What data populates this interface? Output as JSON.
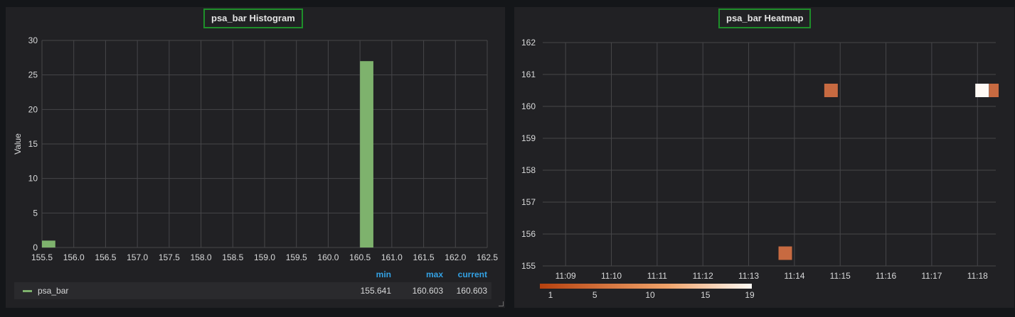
{
  "histogram_panel": {
    "title": "psa_bar Histogram",
    "legend": {
      "headers": [
        "min",
        "max",
        "current"
      ],
      "series_name": "psa_bar",
      "min": "155.641",
      "max": "160.603",
      "current": "160.603"
    }
  },
  "heatmap_panel": {
    "title": "psa_bar Heatmap",
    "color_legend": {
      "ticks": [
        "1",
        "5",
        "10",
        "15",
        "19"
      ],
      "colors": [
        "#b7410e",
        "#fffaf5"
      ]
    }
  },
  "colors": {
    "bar": "#7eb26d",
    "accent_header": "#33a2e5",
    "title_border": "#1e8f2a",
    "panel_bg": "#212124"
  },
  "chart_data": [
    {
      "type": "bar",
      "title": "psa_bar Histogram",
      "xlabel": "",
      "ylabel": "Value",
      "x_ticks": [
        "155.5",
        "156.0",
        "156.5",
        "157.0",
        "157.5",
        "158.0",
        "158.5",
        "159.0",
        "159.5",
        "160.0",
        "160.5",
        "161.0",
        "161.5",
        "162.0",
        "162.5"
      ],
      "y_ticks": [
        "0",
        "5",
        "10",
        "15",
        "20",
        "25",
        "30"
      ],
      "xlim": [
        155.5,
        162.5
      ],
      "ylim": [
        0,
        30
      ],
      "series": [
        {
          "name": "psa_bar",
          "bins": [
            {
              "from": 155.5,
              "to": 155.71,
              "value": 1
            },
            {
              "from": 160.5,
              "to": 160.71,
              "value": 27
            }
          ]
        }
      ],
      "grid": true,
      "legend": "bottom"
    },
    {
      "type": "heatmap",
      "title": "psa_bar Heatmap",
      "x_ticks": [
        "11:09",
        "11:10",
        "11:11",
        "11:12",
        "11:13",
        "11:14",
        "11:15",
        "11:16",
        "11:17",
        "11:18"
      ],
      "y_ticks": [
        "155",
        "156",
        "157",
        "158",
        "159",
        "160",
        "161",
        "162"
      ],
      "ylim": [
        155,
        162
      ],
      "xlim_minutes": [
        "11:08.5",
        "11:18.4"
      ],
      "cells": [
        {
          "time": "11:13.8",
          "y": 155.4,
          "count": 5
        },
        {
          "time": "11:14.8",
          "y": 160.5,
          "count": 5
        },
        {
          "time": "11:18.1",
          "y": 160.5,
          "count": 19
        },
        {
          "time": "11:18.4",
          "y": 160.5,
          "count": 5
        }
      ],
      "color_range": [
        1,
        19
      ],
      "grid": true
    }
  ]
}
